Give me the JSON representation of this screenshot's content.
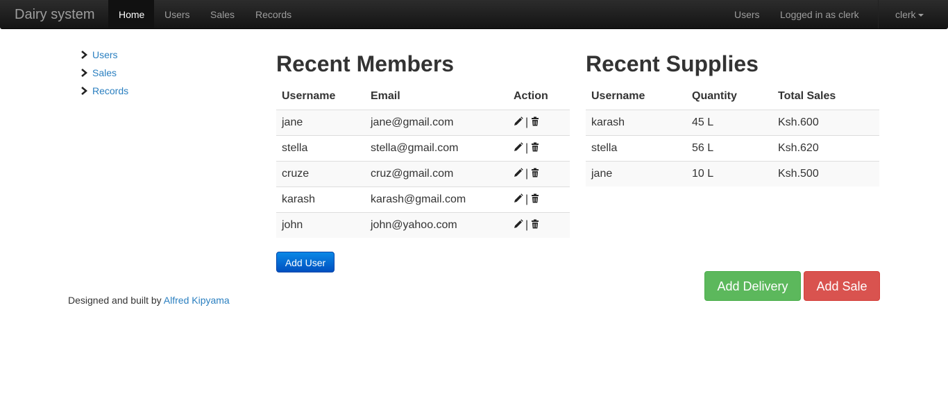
{
  "navbar": {
    "brand": "Dairy system",
    "links": [
      {
        "label": "Home",
        "active": true
      },
      {
        "label": "Users"
      },
      {
        "label": "Sales"
      },
      {
        "label": "Records"
      }
    ],
    "right": {
      "users_label": "Users",
      "logged_in_text": "Logged in as clerk",
      "user_menu_label": "clerk"
    }
  },
  "sidebar": {
    "items": [
      {
        "label": "Users"
      },
      {
        "label": "Sales"
      },
      {
        "label": "Records"
      }
    ]
  },
  "members": {
    "title": "Recent Members",
    "headers": [
      "Username",
      "Email",
      "Action"
    ],
    "action_separator": "|",
    "rows": [
      {
        "username": "jane",
        "email": "jane@gmail.com"
      },
      {
        "username": "stella",
        "email": "stella@gmail.com"
      },
      {
        "username": "cruze",
        "email": "cruz@gmail.com"
      },
      {
        "username": "karash",
        "email": "karash@gmail.com"
      },
      {
        "username": "john",
        "email": "john@yahoo.com"
      }
    ],
    "add_button": "Add User"
  },
  "supplies": {
    "title": "Recent Supplies",
    "headers": [
      "Username",
      "Quantity",
      "Total Sales"
    ],
    "rows": [
      {
        "username": "karash",
        "quantity": "45 L",
        "total": "Ksh.600"
      },
      {
        "username": "stella",
        "quantity": "56 L",
        "total": "Ksh.620"
      },
      {
        "username": "jane",
        "quantity": "10 L",
        "total": "Ksh.500"
      }
    ]
  },
  "actions": {
    "add_delivery": "Add Delivery",
    "add_sale": "Add Sale"
  },
  "footer": {
    "prefix": "Designed and built by",
    "author": "Alfred Kipyama"
  },
  "colors": {
    "link": "#2a7fc0",
    "primary": "#0063d1",
    "success": "#5cb85c",
    "danger": "#d9534f"
  },
  "icons": {
    "sidebar": "chevron-right-icon",
    "edit": "pencil-icon",
    "delete": "trash-icon",
    "user_menu": "caret-down-icon"
  }
}
